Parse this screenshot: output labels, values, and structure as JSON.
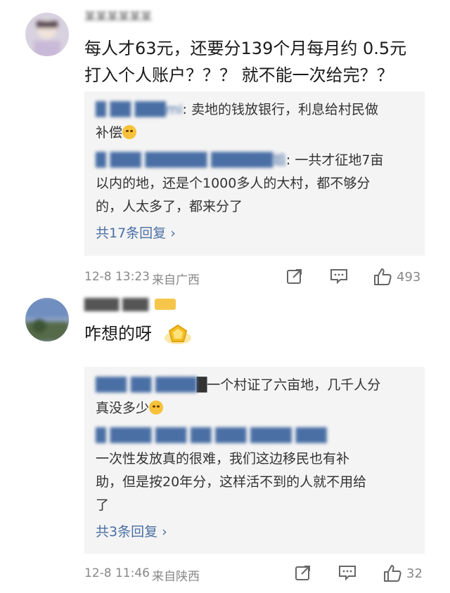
{
  "comments": [
    {
      "username": "某某某某某某",
      "text_line1": "每人才63元，还要分139个月每月约 0.5元",
      "text_line2": "打入个人账户？？？ 就不能一次给完？？",
      "replies": [
        {
          "name": "█ ██ ███mi",
          "text_a": ": 卖地的钱放银行，利息给村民做",
          "text_b": "补偿"
        },
        {
          "name": "█ ███ ██████ ██████姐",
          "text_a": ": 一共才征地7亩",
          "text_b": "以内的地，还是个1000多人的大村，都不够分",
          "text_c": "的，人太多了，都来分了"
        }
      ],
      "more_replies": "共17条回复 ›",
      "time": "12-8 13:23",
      "location": "来自广西",
      "likes": "493"
    },
    {
      "username": "████ ███",
      "text": "咋想的呀",
      "replies": [
        {
          "name": "███ ██ ████",
          "text_a": "█一个村证了六亩地，几千人分",
          "text_b": "真没多少"
        },
        {
          "name": "█ ████ ███ ██ ███ ████ ███",
          "text_a": "一次性发放真的很难，我们这边移民也有补",
          "text_b": "助，但是按20年分，这样活不到的人就不用给",
          "text_c": "了"
        }
      ],
      "more_replies": "共3条回复 ›",
      "time": "12-8 11:46",
      "location": "来自陕西",
      "likes": "32"
    }
  ],
  "icons": {
    "share": "share-icon",
    "comment": "comment-icon",
    "like": "like-icon",
    "emoji": "laugh-cry-emoji",
    "badge": "gold-badge-icon"
  },
  "colors": {
    "link": "#4a6fa5",
    "reply_bg": "#f4f4f4",
    "meta": "#888888"
  }
}
